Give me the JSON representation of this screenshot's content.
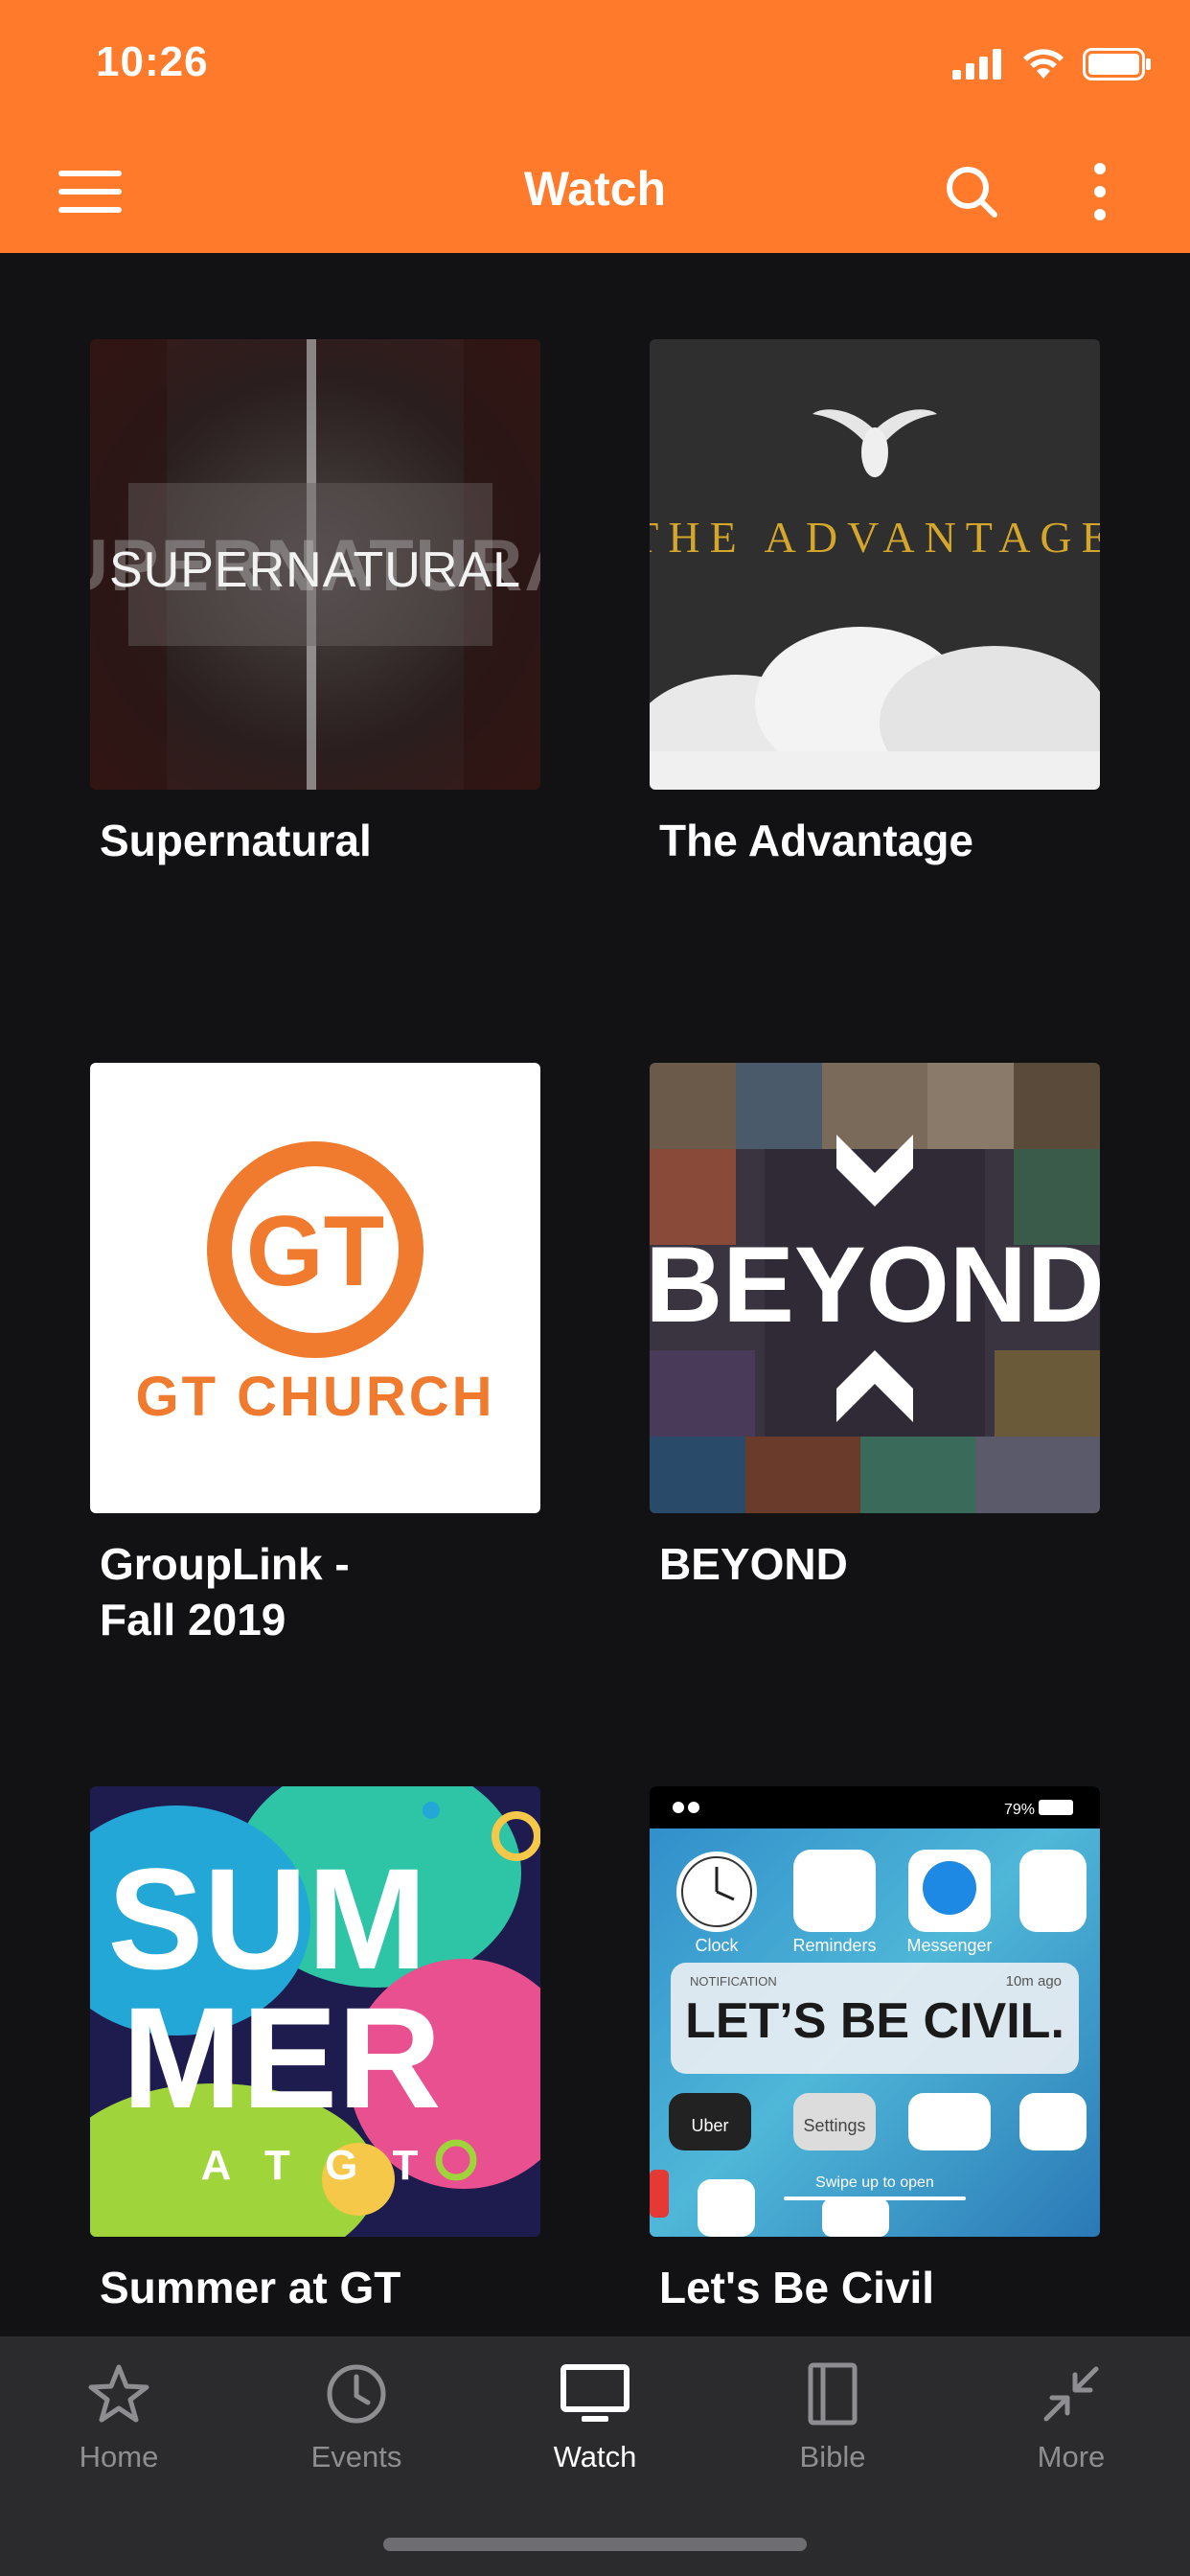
{
  "status_bar": {
    "time": "10:26"
  },
  "header": {
    "title": "Watch"
  },
  "colors": {
    "accent": "#FF7A2A",
    "background": "#121214",
    "tabbar": "#2B2B2D"
  },
  "icons": {
    "menu": "hamburger-icon",
    "search": "search-icon",
    "more": "vertical-dots-icon"
  },
  "items": [
    {
      "title": "Supernatural",
      "art_text": "SUPERNATURAL"
    },
    {
      "title": "The Advantage",
      "art_text": "THE ADVANTAGE"
    },
    {
      "title": "GroupLink -\nFall 2019",
      "art_text": "GT",
      "art_subtext": "GT CHURCH"
    },
    {
      "title": "BEYOND",
      "art_text": "BEYOND"
    },
    {
      "title": "Summer at GT",
      "art_text": "SUM",
      "art_text2": "MER",
      "art_subtext": "A T G T"
    },
    {
      "title": "Let's Be Civil",
      "art_text": "LET’S BE CIVIL.",
      "art_time": "10m ago",
      "art_label": "NOTIFICATION",
      "art_battery": "79%",
      "art_swipe": "Swipe up to open",
      "art_clock": "Clock",
      "art_reminders": "Reminders",
      "art_messenger": "Messenger",
      "art_settings": "Settings",
      "art_uber": "Uber"
    }
  ],
  "tabs": [
    {
      "label": "Home",
      "icon": "star-icon",
      "active": false
    },
    {
      "label": "Events",
      "icon": "clock-icon",
      "active": false
    },
    {
      "label": "Watch",
      "icon": "tv-icon",
      "active": true
    },
    {
      "label": "Bible",
      "icon": "book-icon",
      "active": false
    },
    {
      "label": "More",
      "icon": "collapse-arrows-icon",
      "active": false
    }
  ]
}
